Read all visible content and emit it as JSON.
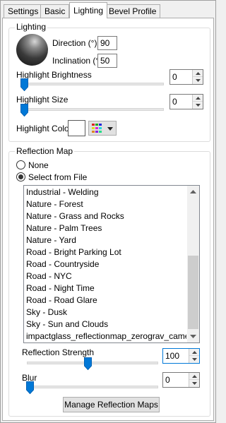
{
  "tabs": [
    {
      "label": "Settings"
    },
    {
      "label": "Basic"
    },
    {
      "label": "Lighting"
    },
    {
      "label": "Bevel Profile"
    }
  ],
  "lighting": {
    "title": "Lighting",
    "direction_label": "Direction (°)",
    "direction_value": "90",
    "inclination_label": "Inclination (°)",
    "inclination_value": "50",
    "highlight_brightness_label": "Highlight Brightness",
    "highlight_brightness_value": "0",
    "highlight_size_label": "Highlight Size",
    "highlight_size_value": "0",
    "highlight_color_label": "Highlight Color",
    "highlight_color": "#ffffff"
  },
  "reflection": {
    "title": "Reflection Map",
    "option_none": "None",
    "option_file": "Select from File",
    "selected_option": "Select from File",
    "items": [
      "Industrial - Welding",
      "Nature - Forest",
      "Nature - Grass and Rocks",
      "Nature - Palm Trees",
      "Nature - Yard",
      "Road - Bright Parking Lot",
      "Road - Countryside",
      "Road - NYC",
      "Road - Night Time",
      "Road - Road Glare",
      "Sky - Dusk",
      "Sky - Sun and Clouds",
      "impactglass_reflectionmap_zerograv_camerobject"
    ],
    "strength_label": "Reflection Strength",
    "strength_value": "100",
    "blur_label": "Blur",
    "blur_value": "0",
    "manage_button": "Manage Reflection Maps"
  },
  "colors": {
    "accent": "#0078d7",
    "border": "#adadad"
  }
}
